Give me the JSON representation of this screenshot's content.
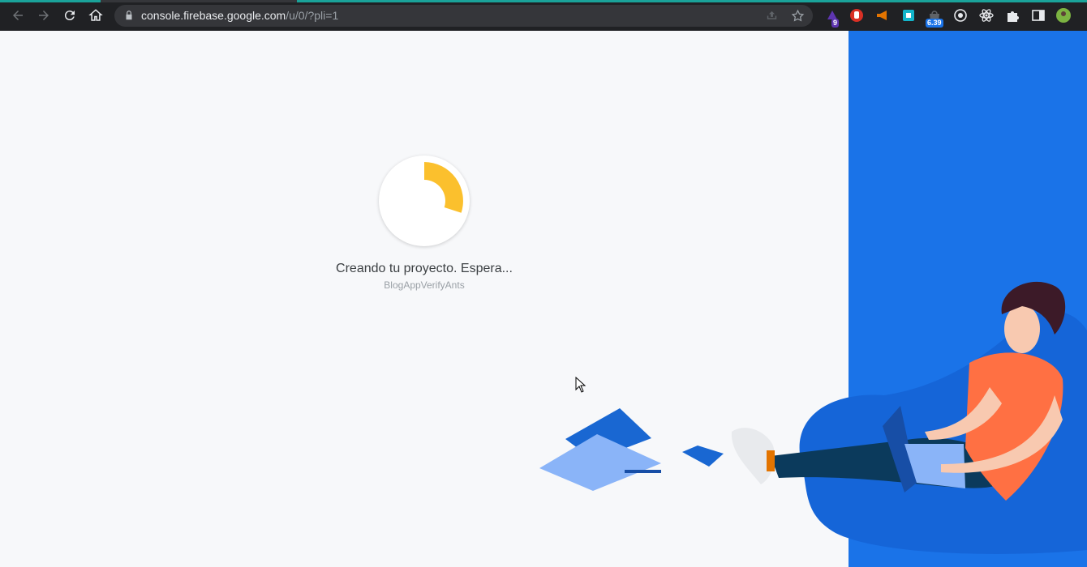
{
  "browser": {
    "url_host": "console.firebase.google.com",
    "url_path": "/u/0/?pli=1",
    "extensions": [
      {
        "name": "purple-extension-icon",
        "badge": "9",
        "color": "#5e35b1",
        "badge_color": "#5e35b1"
      },
      {
        "name": "hand-stop-extension-icon",
        "color": "#d93025"
      },
      {
        "name": "megaphone-extension-icon",
        "color": "#e37400"
      },
      {
        "name": "square-extension-icon",
        "color": "#12b5cb"
      },
      {
        "name": "bag-extension-icon",
        "badge": "6.39",
        "color": "#5f6368",
        "badge_color": "#1a73e8"
      },
      {
        "name": "target-extension-icon",
        "color": "#e8eaed"
      },
      {
        "name": "react-extension-icon",
        "color": "#e8eaed"
      },
      {
        "name": "puzzle-extensions-icon",
        "color": "#e8eaed"
      },
      {
        "name": "side-panel-icon",
        "color": "#e8eaed"
      },
      {
        "name": "profile-avatar",
        "color": "#7cb342"
      }
    ]
  },
  "loader": {
    "status": "Creando tu proyecto. Espera...",
    "project": "BlogAppVerifyAnts",
    "progress_color": "#fbc02d"
  },
  "colors": {
    "panel": "#1a73e8",
    "page_bg": "#f7f8fa"
  }
}
